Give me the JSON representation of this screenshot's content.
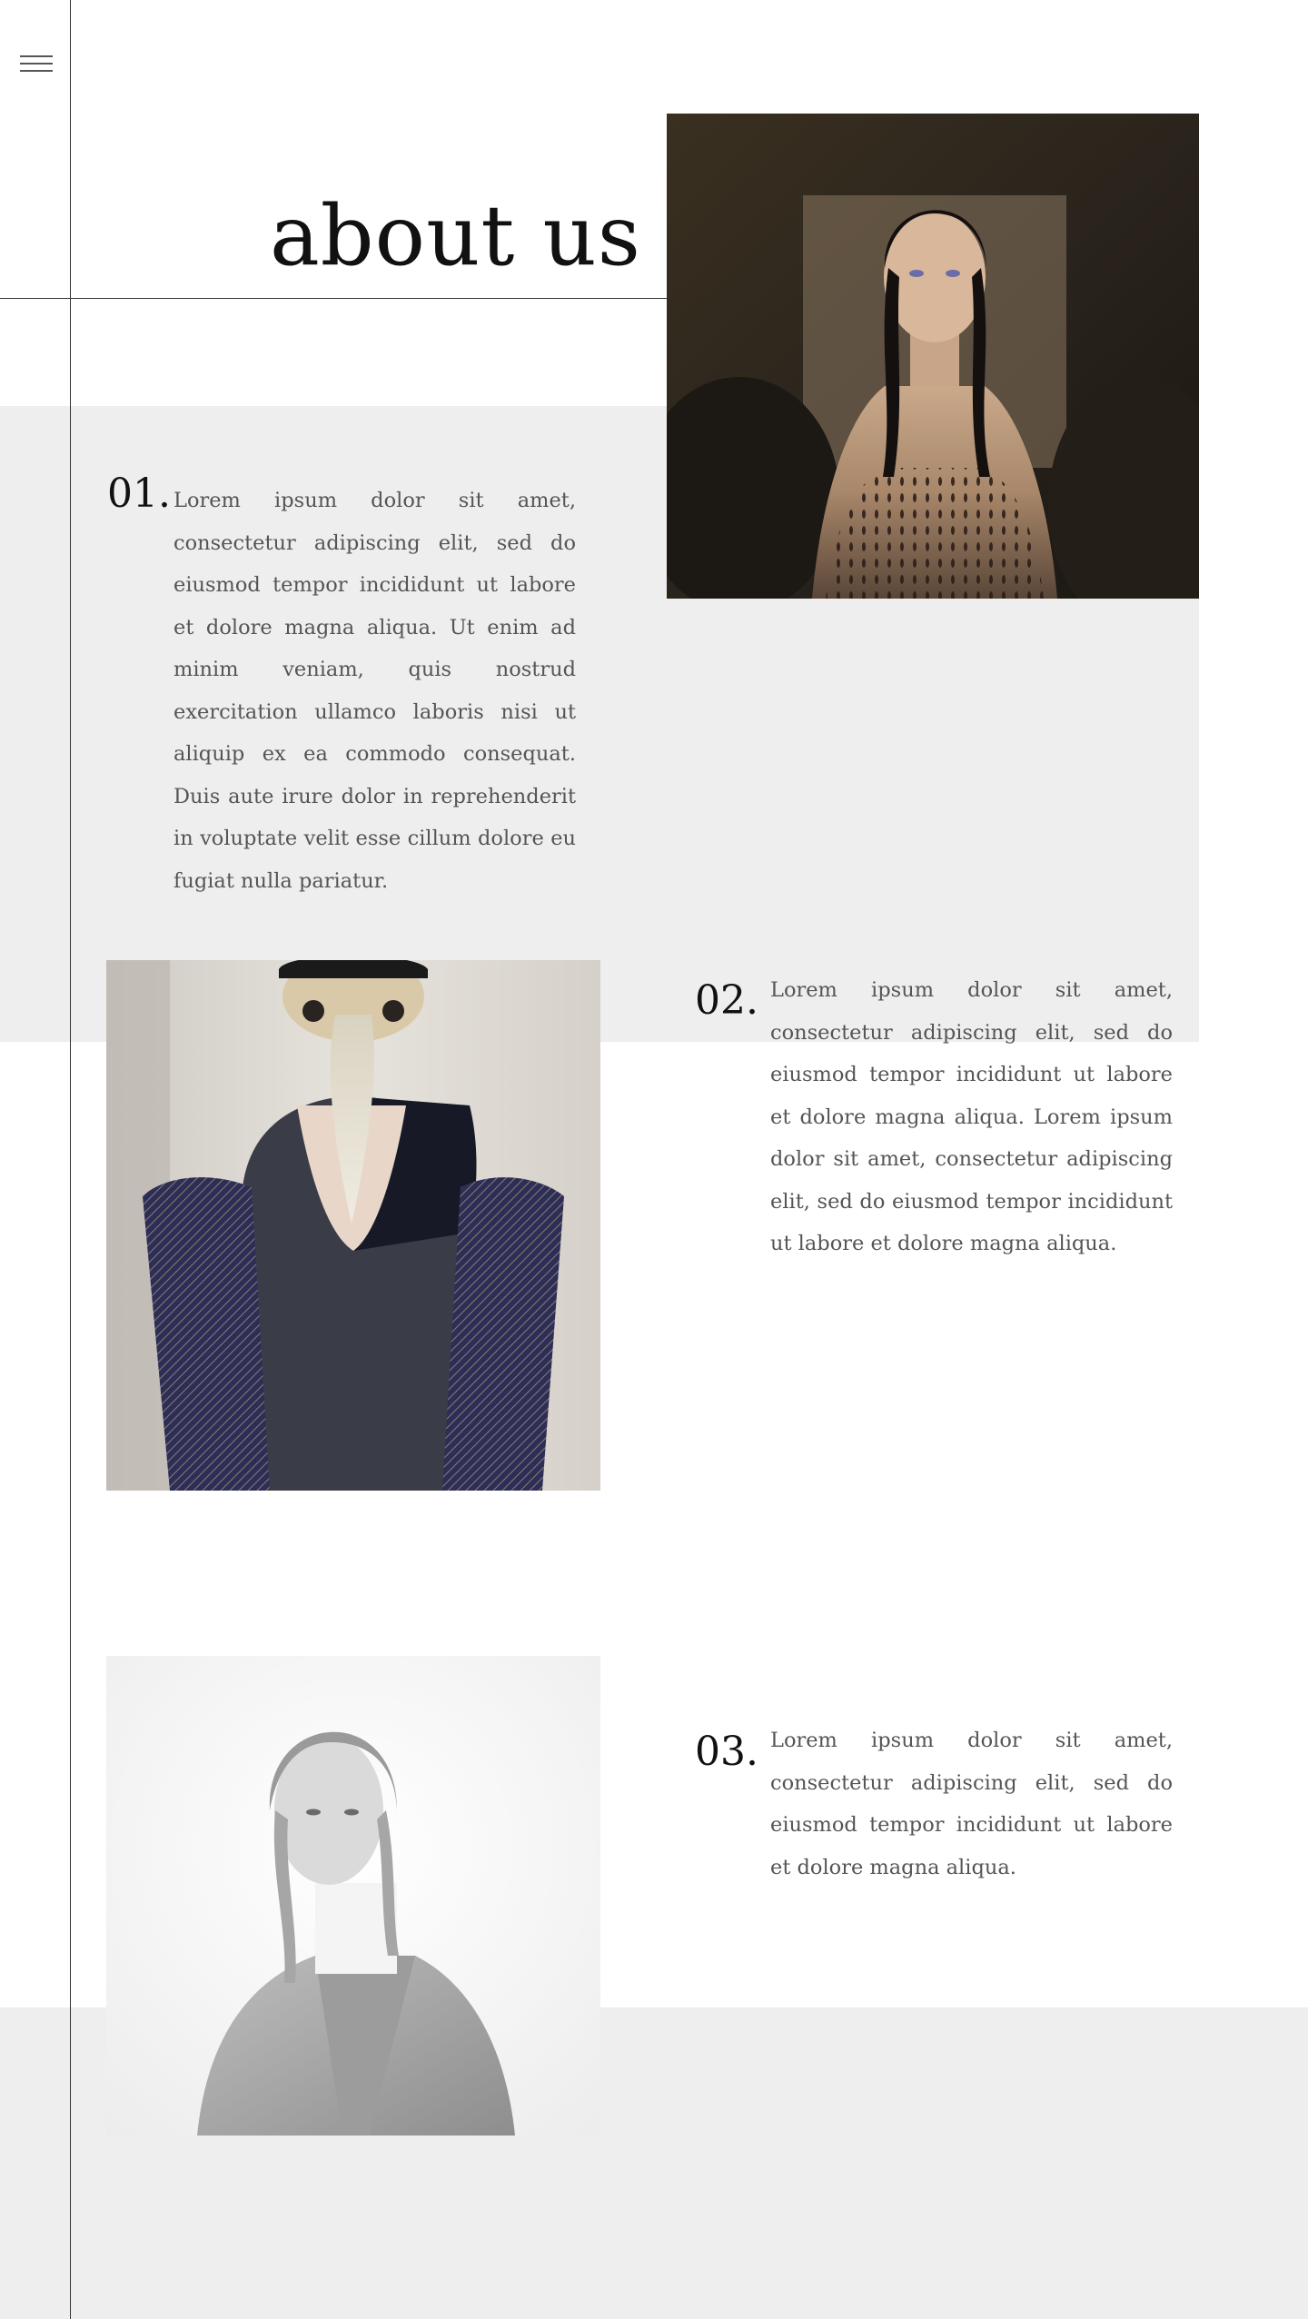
{
  "page": {
    "title": "about us"
  },
  "menu": {
    "icon": "hamburger-menu-icon"
  },
  "sections": [
    {
      "number": "01.",
      "text": "Lorem ipsum dolor sit amet, consectetur adipiscing elit, sed do eiusmod tempor incididunt ut labore et dolore magna aliqua. Ut enim ad minim veniam, quis nostrud exercitation ullamco laboris nisi ut aliquip ex ea commodo consequat. Duis aute irure dolor in reprehenderit in voluptate velit esse cillum dolore eu fugiat nulla pariatur."
    },
    {
      "number": "02.",
      "text": "Lorem ipsum dolor sit amet, consectetur adipiscing elit, sed do eiusmod tempor incididunt ut labore et dolore magna aliqua. Lorem ipsum dolor sit amet, consectetur adipiscing elit, sed do eiusmod tempor incididunt ut labore et dolore magna aliqua."
    },
    {
      "number": "03.",
      "text": "Lorem ipsum dolor sit amet, consectetur adipiscing elit, sed do eiusmod tempor incididunt ut labore et dolore magna aliqua."
    }
  ],
  "colors": {
    "background": "#ffffff",
    "band": "#eeeeee",
    "heading": "#111111",
    "body_text": "#555555",
    "rule": "#333333"
  }
}
